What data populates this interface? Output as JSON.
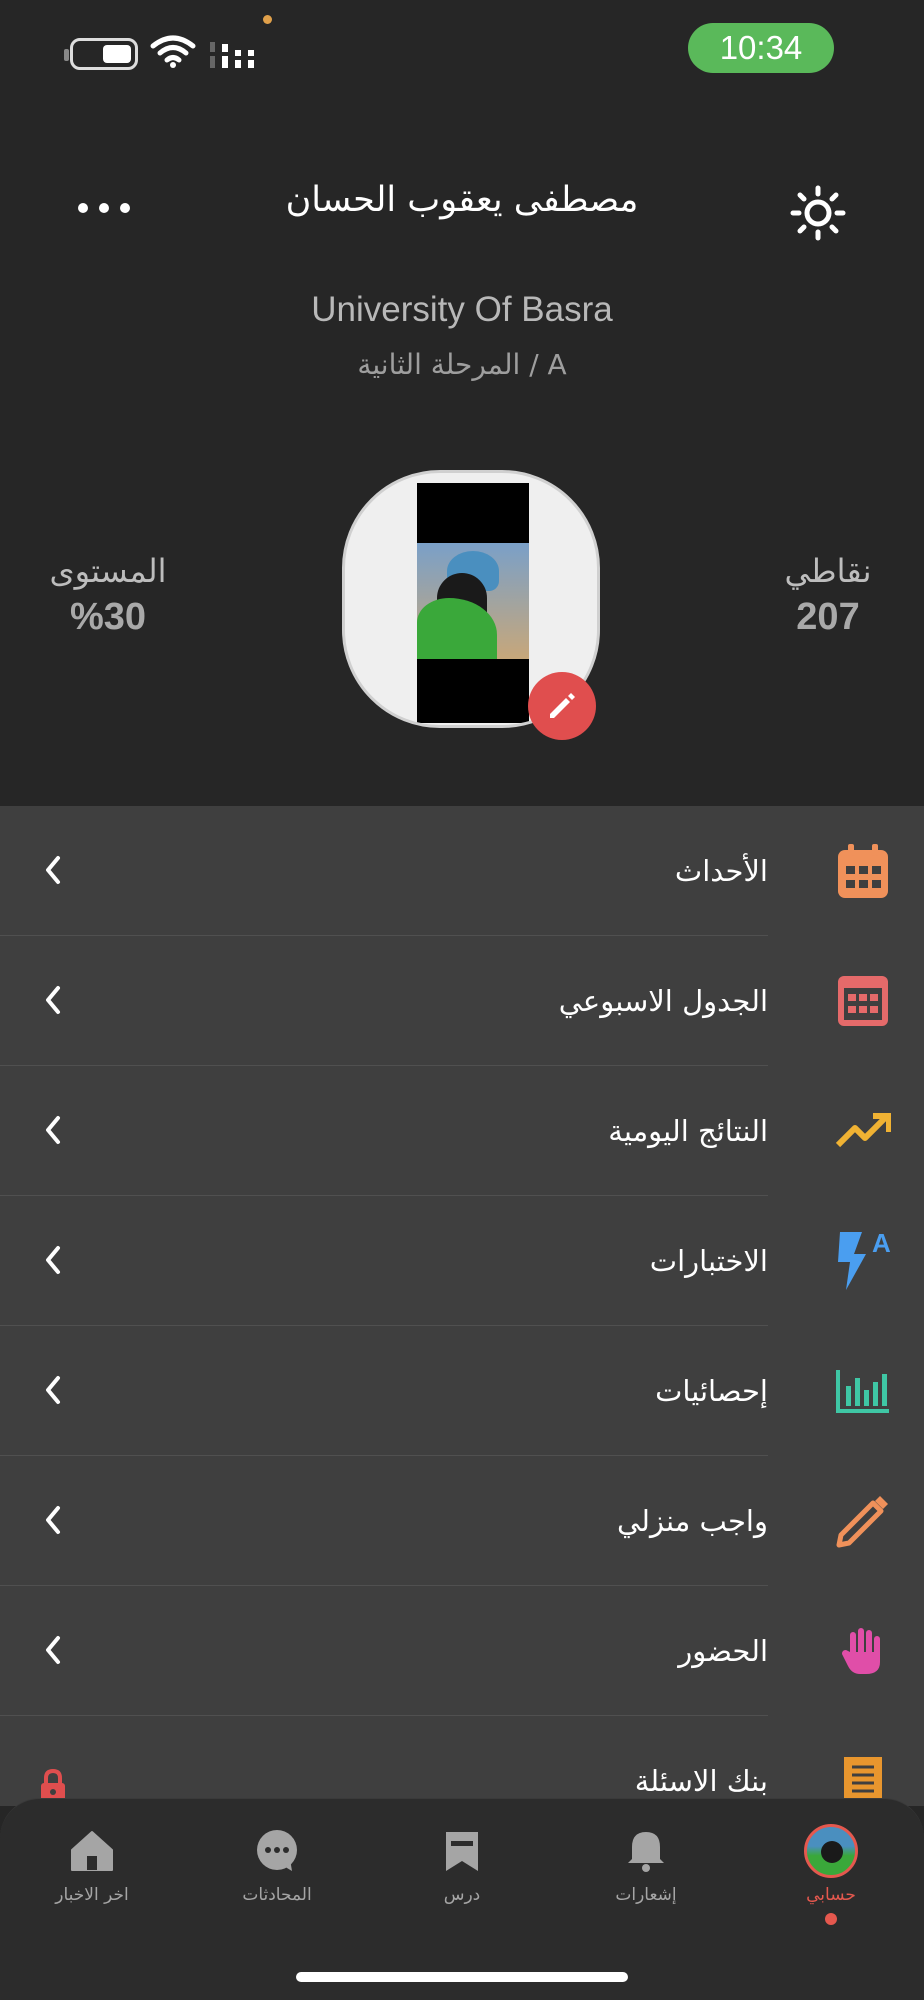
{
  "status_bar": {
    "time": "10:34",
    "time_pill_color": "#5ab95a",
    "battery_icon": "battery-icon",
    "wifi_icon": "wifi-icon",
    "signal_icon": "signal-icon"
  },
  "header": {
    "user_name": "مصطفى يعقوب الحسان",
    "more_icon": "more-dots-icon",
    "theme_icon": "sun-icon"
  },
  "profile": {
    "university": "University Of Basra",
    "stage": "المرحلة الثانية / A",
    "level_label": "المستوى",
    "level_value": "%30",
    "points_label": "نقاطي",
    "points_value": "207",
    "edit_icon": "pencil-icon",
    "edit_color": "#e04e4e"
  },
  "menu": {
    "items": [
      {
        "label": "الأحداث",
        "icon": "calendar-icon",
        "color": "#f0915a",
        "locked": false
      },
      {
        "label": "الجدول الاسبوعي",
        "icon": "weekly-calendar-icon",
        "color": "#e56a6a",
        "locked": false
      },
      {
        "label": "النتائج اليومية",
        "icon": "trending-up-icon",
        "color": "#f0b233",
        "locked": false
      },
      {
        "label": "الاختبارات",
        "icon": "quiz-flash-icon",
        "color": "#4a9ef0",
        "locked": false
      },
      {
        "label": "إحصائيات",
        "icon": "bar-chart-icon",
        "color": "#3fc7a5",
        "locked": false
      },
      {
        "label": "واجب منزلي",
        "icon": "pencil-icon",
        "color": "#f0915a",
        "locked": false
      },
      {
        "label": "الحضور",
        "icon": "hand-icon",
        "color": "#e04ea8",
        "locked": false
      },
      {
        "label": "بنك الاسئلة",
        "icon": "receipt-icon",
        "color": "#e8962e",
        "locked": true
      }
    ]
  },
  "tabbar": {
    "items": [
      {
        "label": "اخر الاخبار",
        "icon": "home-icon",
        "active": false
      },
      {
        "label": "المحادثات",
        "icon": "chat-icon",
        "active": false
      },
      {
        "label": "درس",
        "icon": "bookmark-icon",
        "active": false
      },
      {
        "label": "إشعارات",
        "icon": "bell-icon",
        "active": false
      },
      {
        "label": "حسابي",
        "icon": "avatar-icon",
        "active": true
      }
    ],
    "active_color": "#e5584e"
  }
}
